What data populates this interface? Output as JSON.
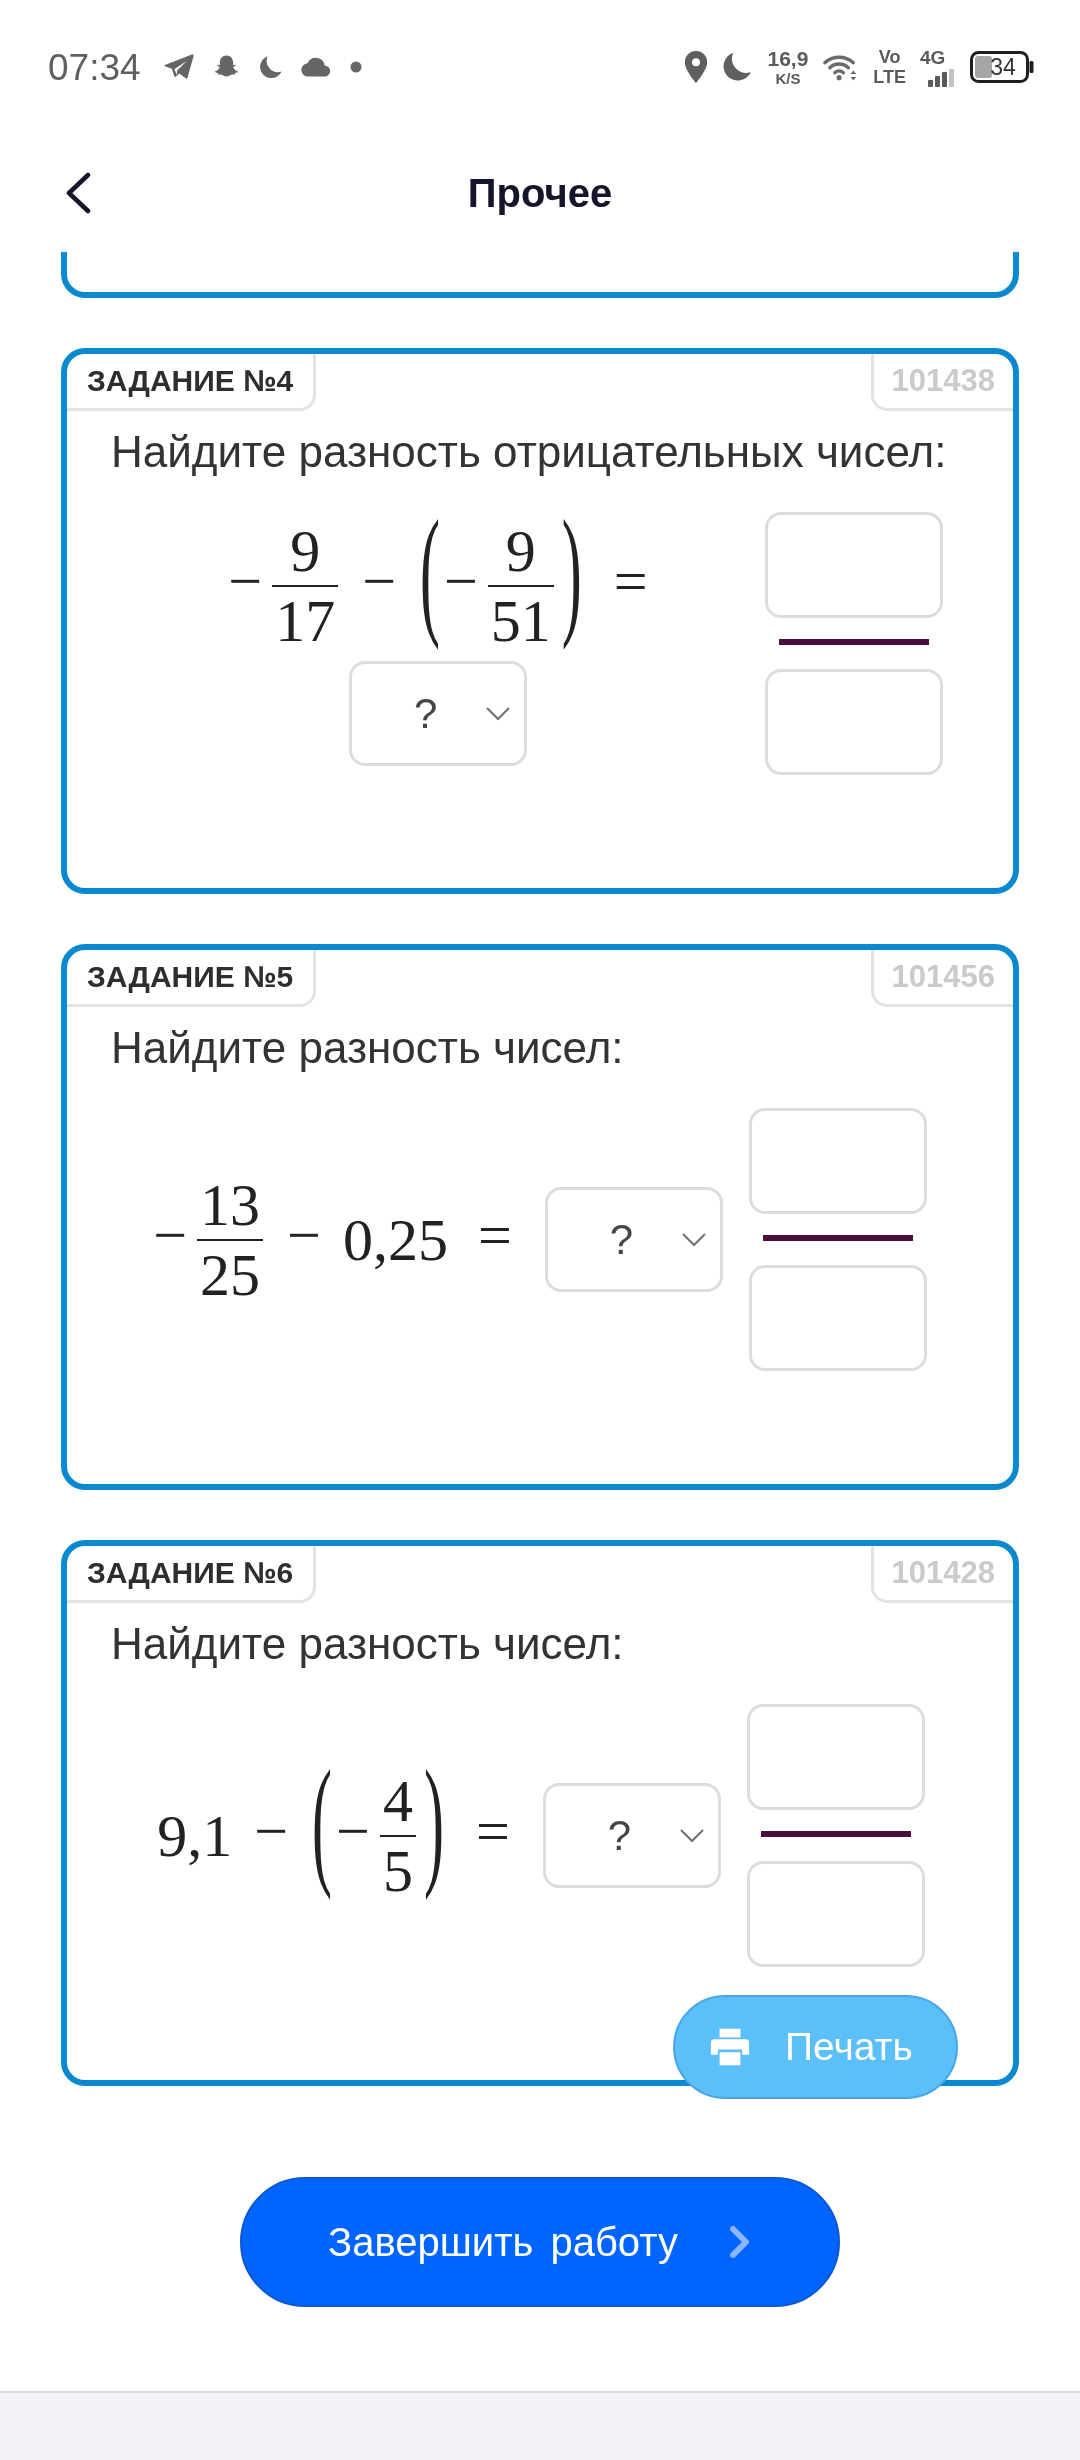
{
  "status_bar": {
    "time": "07:34",
    "net_speed": "16,9",
    "net_unit": "K/S",
    "volte_top": "Vo",
    "volte_bottom": "LTE",
    "network": "4G",
    "battery": "34"
  },
  "header": {
    "title": "Прочее"
  },
  "tasks": [
    {
      "label": "ЗАДАНИЕ №4",
      "number": "101438",
      "question": "Найдите разность отрицательных чисел:",
      "expression": [
        {
          "kind": "op",
          "text": "−"
        },
        {
          "kind": "frac",
          "num": "9",
          "den": "17"
        },
        {
          "kind": "op",
          "text": "−"
        },
        {
          "kind": "parens",
          "open": "(",
          "close": ")",
          "items": [
            {
              "kind": "op",
              "text": "−"
            },
            {
              "kind": "frac",
              "num": "9",
              "den": "51"
            }
          ]
        },
        {
          "kind": "rel",
          "text": "="
        }
      ],
      "answer": [
        {
          "kind": "select",
          "placeholder": "?"
        },
        {
          "kind": "fraction"
        }
      ]
    },
    {
      "label": "ЗАДАНИЕ №5",
      "number": "101456",
      "question": "Найдите разность чисел:",
      "expression": [
        {
          "kind": "op",
          "text": "−"
        },
        {
          "kind": "frac",
          "num": "13",
          "den": "25"
        },
        {
          "kind": "op",
          "text": "−"
        },
        {
          "kind": "num",
          "text": "0,25"
        },
        {
          "kind": "rel",
          "text": "="
        }
      ],
      "answer": [
        {
          "kind": "select",
          "placeholder": "?"
        },
        {
          "kind": "fraction"
        }
      ]
    },
    {
      "label": "ЗАДАНИЕ №6",
      "number": "101428",
      "question": "Найдите разность чисел:",
      "expression": [
        {
          "kind": "num",
          "text": "9,1"
        },
        {
          "kind": "op",
          "text": "−"
        },
        {
          "kind": "parens",
          "open": "(",
          "close": ")",
          "items": [
            {
              "kind": "op",
              "text": "−"
            },
            {
              "kind": "frac",
              "num": "4",
              "den": "5"
            }
          ]
        },
        {
          "kind": "rel",
          "text": "="
        }
      ],
      "answer": [
        {
          "kind": "select",
          "placeholder": "?"
        },
        {
          "kind": "fraction"
        }
      ]
    }
  ],
  "print_button": {
    "label": "Печать"
  },
  "finish_button": {
    "label": "Завершить работу"
  }
}
